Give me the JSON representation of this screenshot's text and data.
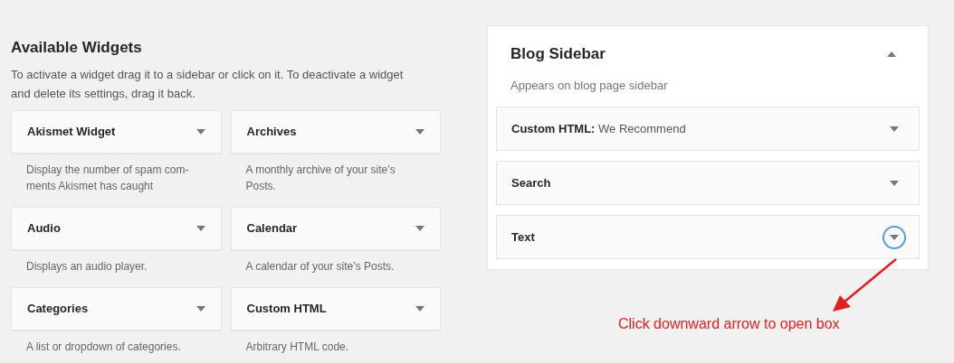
{
  "available_widgets": {
    "title": "Available Widgets",
    "description": "To activate a widget drag it to a sidebar or click on it. To deactivate a widget and delete its settings, drag it back.",
    "widgets": [
      {
        "name": "Akismet Widget",
        "description": "Display the number of spam com-ments Akismet has caught"
      },
      {
        "name": "Archives",
        "description": "A monthly archive of your site’s Posts."
      },
      {
        "name": "Audio",
        "description": "Displays an audio player."
      },
      {
        "name": "Calendar",
        "description": "A calendar of your site’s Posts."
      },
      {
        "name": "Categories",
        "description": "A list or dropdown of categories."
      },
      {
        "name": "Custom HTML",
        "description": "Arbitrary HTML code."
      }
    ]
  },
  "sidebar": {
    "title": "Blog Sidebar",
    "description": "Appears on blog page sidebar",
    "expanded": true,
    "items": [
      {
        "label": "**Custom HTML:** We Recommend",
        "focused": false
      },
      {
        "label": "Search",
        "focused": false
      },
      {
        "label": "Text",
        "focused": true
      }
    ]
  },
  "annotation": {
    "text": "Click downward arrow to open box"
  }
}
